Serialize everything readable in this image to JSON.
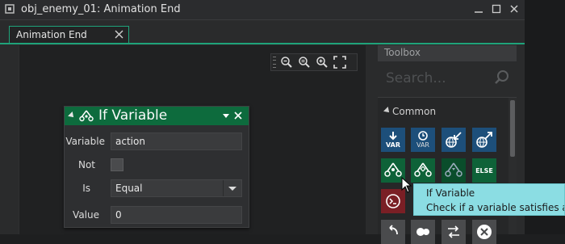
{
  "window": {
    "title": "obj_enemy_01: Animation End",
    "accent_color": "#1fa37a"
  },
  "tabs": [
    {
      "label": "Animation End"
    }
  ],
  "zoom_toolbar": {
    "buttons": [
      "zoom-out-icon",
      "zoom-reset-icon",
      "zoom-in-icon",
      "fit-screen-icon"
    ]
  },
  "node": {
    "title": "If Variable",
    "header_color": "#0d6b3d",
    "fields": {
      "variable_label": "Variable",
      "variable_value": "action",
      "not_label": "Not",
      "is_label": "Is",
      "is_value": "Equal",
      "value_label": "Value",
      "value_value": "0"
    }
  },
  "toolbox": {
    "title": "Toolbox",
    "search_placeholder": "Search...",
    "section": "Common",
    "actions_row1": [
      "VAR",
      "VAR",
      "",
      ""
    ],
    "actions_row2": [
      "",
      "",
      "",
      "ELSE"
    ]
  },
  "tooltip": {
    "title": "If Variable",
    "description": "Check if a variable satisfies a co"
  }
}
